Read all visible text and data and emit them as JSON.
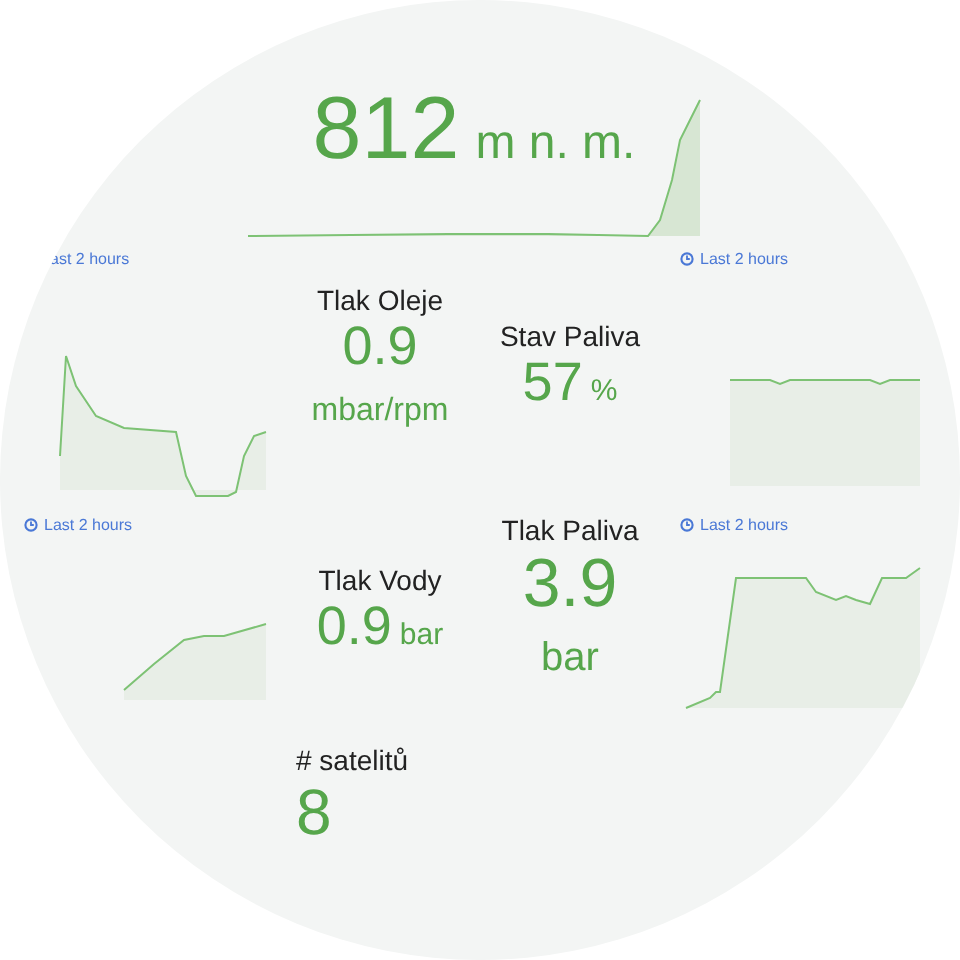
{
  "altitude": {
    "value": "812",
    "unit": "m n. m."
  },
  "time_ranges": [
    {
      "label": "ast 2 hours",
      "kind": "plain"
    },
    {
      "label": "Last 2 hours",
      "kind": "timed"
    },
    {
      "label": "Last 2 hours",
      "kind": "timed"
    },
    {
      "label": "Last 2 hours",
      "kind": "timed"
    }
  ],
  "stats": [
    {
      "title": "Tlak Oleje",
      "value": "0.9",
      "unit": "mbar/rpm",
      "kind": "stacked"
    },
    {
      "title": "Stav Paliva",
      "value": "57",
      "unit": "%",
      "kind": "inline"
    },
    {
      "title": "Tlak Vody",
      "value": "0.9",
      "unit": "bar",
      "kind": "inline"
    },
    {
      "title": "Tlak Paliva",
      "value": "3.9",
      "unit": "bar",
      "kind": "stacked"
    },
    {
      "title": "# satelitů",
      "value": "8",
      "kind": "inline"
    }
  ]
}
